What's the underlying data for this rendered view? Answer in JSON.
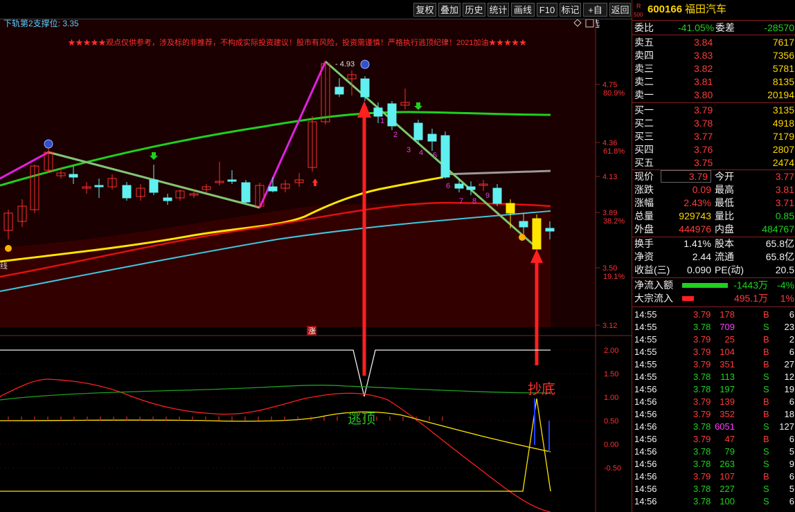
{
  "toolbar": {
    "buttons": [
      "复权",
      "叠加",
      "历史",
      "统计",
      "画线",
      "F10",
      "标记",
      "+自选",
      "返回"
    ]
  },
  "chart": {
    "indicator_label": "下轨第2支撑位: 3.35",
    "notice": "★★★★★观点仅供参考，涉及标的非推荐，不构成实际投资建议！股市有风险，投资需谨慎！严格执行逃顶纪律！2021加油★★★★★",
    "high_label": "4.93",
    "left_label": "线",
    "zhang_mark": "涨",
    "wave_numbers": [
      "1",
      "2",
      "3",
      "4",
      "5",
      "6",
      "7",
      "8",
      "9"
    ],
    "price_axis": [
      {
        "v": "4.75",
        "p": "80.9%"
      },
      {
        "v": "4.36",
        "p": "61.8%"
      },
      {
        "v": "4.13",
        "p": ""
      },
      {
        "v": "3.89",
        "p": "38.2%"
      },
      {
        "v": "3.50",
        "p": "19.1%"
      },
      {
        "v": "3.12",
        "p": ""
      }
    ],
    "ind_axis": [
      "2.00",
      "1.50",
      "1.00",
      "0.50",
      "0.00",
      "-0.50"
    ],
    "ann_top": "逃顶",
    "ann_bottom": "抄底",
    "colors": {
      "green_ma": "#20d020",
      "yellow_ma": "#ffe600",
      "red_ma": "#e01010",
      "cyan_ma": "#40c8e0",
      "trend": "#7cc870",
      "magenta": "#e020e0",
      "up": "#ff3030",
      "down": "#60f0f0"
    }
  },
  "quote": {
    "r_badge": "R",
    "num_badge": "500",
    "code": "600166",
    "name": "福田汽车",
    "weibi_label": "委比",
    "weibi": "-41.05%",
    "weicha_label": "委差",
    "weicha": "-28570",
    "asks": [
      {
        "label": "卖五",
        "price": "3.84",
        "vol": "7617"
      },
      {
        "label": "卖四",
        "price": "3.83",
        "vol": "7356"
      },
      {
        "label": "卖三",
        "price": "3.82",
        "vol": "5781"
      },
      {
        "label": "卖二",
        "price": "3.81",
        "vol": "8135"
      },
      {
        "label": "卖一",
        "price": "3.80",
        "vol": "20194"
      }
    ],
    "bids": [
      {
        "label": "买一",
        "price": "3.79",
        "vol": "3135"
      },
      {
        "label": "买二",
        "price": "3.78",
        "vol": "4918"
      },
      {
        "label": "买三",
        "price": "3.77",
        "vol": "7179"
      },
      {
        "label": "买四",
        "price": "3.76",
        "vol": "2807"
      },
      {
        "label": "买五",
        "price": "3.75",
        "vol": "2474"
      }
    ],
    "stats": [
      {
        "l1": "现价",
        "v1": "3.79",
        "l2": "今开",
        "v2": "3.77"
      },
      {
        "l1": "涨跌",
        "v1": "0.09",
        "l2": "最高",
        "v2": "3.81"
      },
      {
        "l1": "涨幅",
        "v1": "2.43%",
        "l2": "最低",
        "v2": "3.71"
      },
      {
        "l1": "总量",
        "v1": "929743",
        "l2": "量比",
        "v2": "0.85"
      },
      {
        "l1": "外盘",
        "v1": "444976",
        "l2": "内盘",
        "v2": "484767"
      }
    ],
    "stats2": [
      {
        "l1": "换手",
        "v1": "1.41%",
        "l2": "股本",
        "v2": "65.8亿"
      },
      {
        "l1": "净资",
        "v1": "2.44",
        "l2": "流通",
        "v2": "65.8亿"
      },
      {
        "l1": "收益(三)",
        "v1": "0.090",
        "l2": "PE(动)",
        "v2": "20.5"
      }
    ],
    "flows": [
      {
        "label": "净流入额",
        "amount": "-1443万",
        "pct": "-4%",
        "fill": 0.6
      },
      {
        "label": "大宗流入",
        "amount": "495.1万",
        "pct": "1%",
        "fill": 0.15
      }
    ]
  },
  "ticks": [
    {
      "t": "14:55",
      "p": "3.79",
      "v": "178",
      "d": "B",
      "n": "6"
    },
    {
      "t": "14:55",
      "p": "3.78",
      "v": "709",
      "d": "S",
      "n": "23"
    },
    {
      "t": "14:55",
      "p": "3.79",
      "v": "25",
      "d": "B",
      "n": "2"
    },
    {
      "t": "14:55",
      "p": "3.79",
      "v": "104",
      "d": "B",
      "n": "6"
    },
    {
      "t": "14:55",
      "p": "3.79",
      "v": "351",
      "d": "B",
      "n": "27"
    },
    {
      "t": "14:55",
      "p": "3.78",
      "v": "113",
      "d": "S",
      "n": "12"
    },
    {
      "t": "14:56",
      "p": "3.78",
      "v": "197",
      "d": "S",
      "n": "19"
    },
    {
      "t": "14:56",
      "p": "3.79",
      "v": "139",
      "d": "B",
      "n": "6"
    },
    {
      "t": "14:56",
      "p": "3.79",
      "v": "352",
      "d": "B",
      "n": "18"
    },
    {
      "t": "14:56",
      "p": "3.78",
      "v": "6051",
      "d": "S",
      "n": "127"
    },
    {
      "t": "14:56",
      "p": "3.79",
      "v": "47",
      "d": "B",
      "n": "6"
    },
    {
      "t": "14:56",
      "p": "3.78",
      "v": "79",
      "d": "S",
      "n": "5"
    },
    {
      "t": "14:56",
      "p": "3.78",
      "v": "263",
      "d": "S",
      "n": "9"
    },
    {
      "t": "14:56",
      "p": "3.79",
      "v": "107",
      "d": "B",
      "n": "6"
    },
    {
      "t": "14:56",
      "p": "3.78",
      "v": "227",
      "d": "S",
      "n": "5"
    },
    {
      "t": "14:56",
      "p": "3.78",
      "v": "100",
      "d": "S",
      "n": "6"
    }
  ]
}
